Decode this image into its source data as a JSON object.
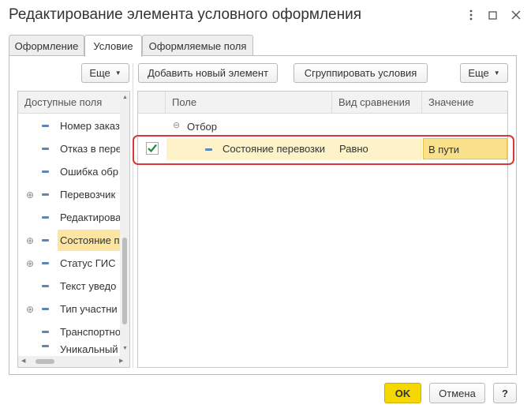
{
  "window": {
    "title": "Редактирование элемента условного оформления"
  },
  "tabs": [
    {
      "label": "Оформление",
      "active": false
    },
    {
      "label": "Условие",
      "active": true
    },
    {
      "label": "Оформляемые поля",
      "active": false
    }
  ],
  "left_panel": {
    "more_label": "Еще",
    "header": "Доступные поля",
    "items": [
      {
        "label": "Номер заказ",
        "expandable": false,
        "selected": false
      },
      {
        "label": "Отказ в пере",
        "expandable": false,
        "selected": false
      },
      {
        "label": "Ошибка обр",
        "expandable": false,
        "selected": false
      },
      {
        "label": "Перевозчик",
        "expandable": true,
        "selected": false
      },
      {
        "label": "Редактирова",
        "expandable": false,
        "selected": false
      },
      {
        "label": "Состояние п",
        "expandable": true,
        "selected": true
      },
      {
        "label": "Статус ГИС",
        "expandable": true,
        "selected": false
      },
      {
        "label": "Текст уведо",
        "expandable": false,
        "selected": false
      },
      {
        "label": "Тип участни",
        "expandable": true,
        "selected": false
      },
      {
        "label": "Транспортно",
        "expandable": false,
        "selected": false
      },
      {
        "label": "Уникальный",
        "expandable": false,
        "selected": false
      }
    ]
  },
  "right_panel": {
    "add_label": "Добавить новый элемент",
    "group_label": "Сгруппировать условия",
    "more_label": "Еще",
    "columns": {
      "field": "Поле",
      "comparison": "Вид сравнения",
      "value": "Значение"
    },
    "group_row": "Отбор",
    "condition": {
      "checked": true,
      "field": "Состояние перевозки",
      "comparison": "Равно",
      "value": "В пути"
    }
  },
  "footer": {
    "ok_label": "OK",
    "cancel_label": "Отмена",
    "help_label": "?"
  },
  "colors": {
    "accent_yellow": "#f5d800",
    "highlight_red": "#d9383a",
    "selection": "#fbe5a0",
    "value_cell": "#f9e08a"
  }
}
